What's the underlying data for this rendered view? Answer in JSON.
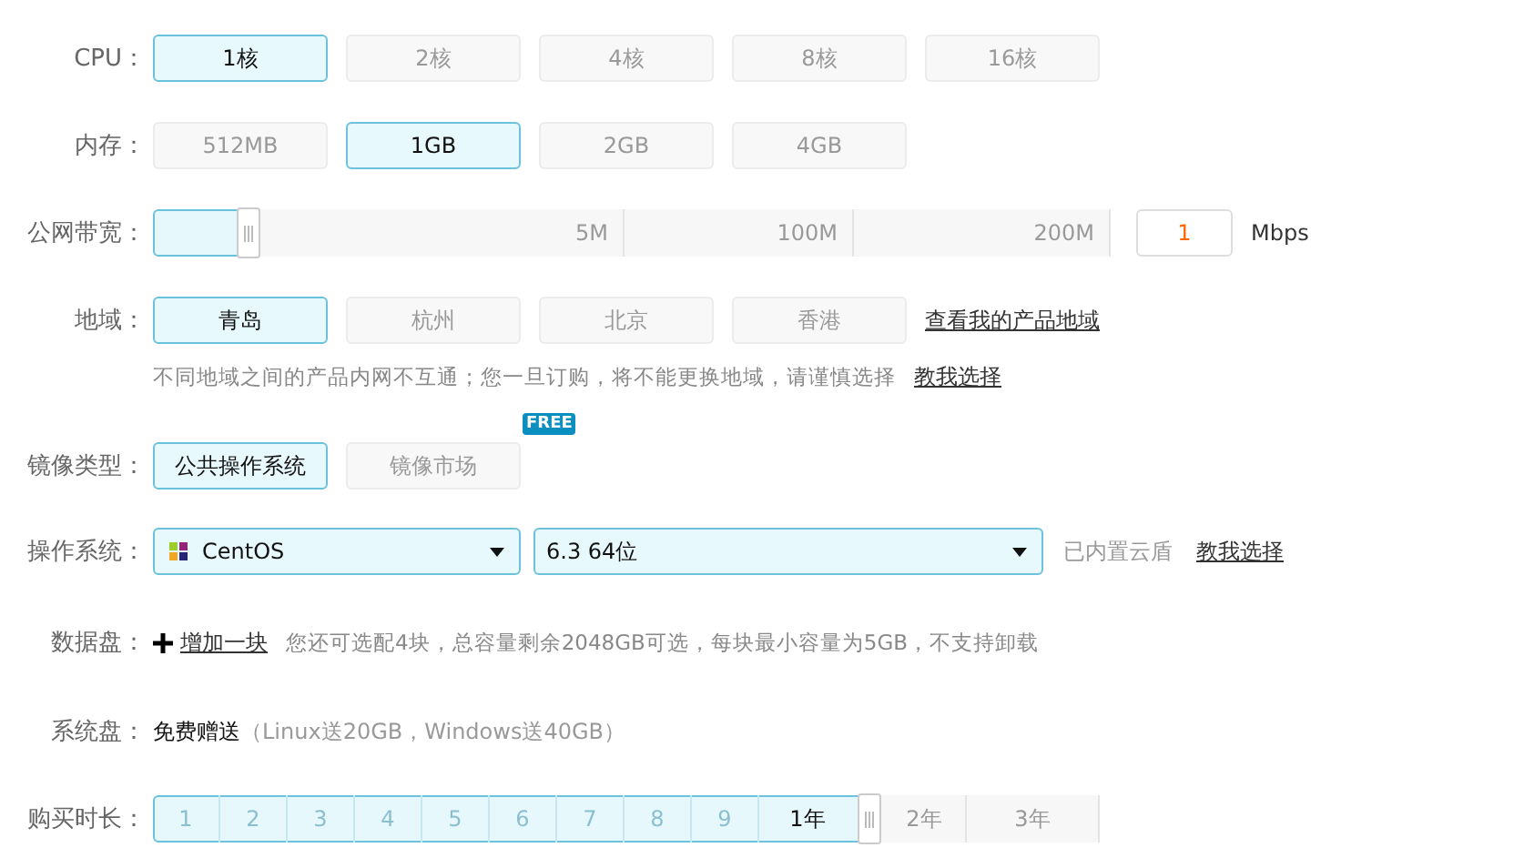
{
  "cpu": {
    "label": "CPU：",
    "options": [
      {
        "label": "1核",
        "selected": true
      },
      {
        "label": "2核",
        "selected": false
      },
      {
        "label": "4核",
        "selected": false
      },
      {
        "label": "8核",
        "selected": false
      },
      {
        "label": "16核",
        "selected": false
      }
    ]
  },
  "memory": {
    "label": "内存：",
    "options": [
      {
        "label": "512MB",
        "selected": false
      },
      {
        "label": "1GB",
        "selected": true
      },
      {
        "label": "2GB",
        "selected": false
      },
      {
        "label": "4GB",
        "selected": false
      }
    ]
  },
  "bandwidth": {
    "label": "公网带宽：",
    "level": 0.1,
    "marks": [
      "5M",
      "100M",
      "200M"
    ],
    "value": "1",
    "unit": "Mbps"
  },
  "region": {
    "label": "地域：",
    "options": [
      {
        "label": "青岛",
        "selected": true
      },
      {
        "label": "杭州",
        "selected": false
      },
      {
        "label": "北京",
        "selected": false
      },
      {
        "label": "香港",
        "selected": false
      }
    ],
    "link": "查看我的产品地域",
    "hint": "不同地域之间的产品内网不互通；您一旦订购，将不能更换地域，请谨慎选择",
    "hint_link": "教我选择"
  },
  "image_type": {
    "label": "镜像类型：",
    "options": [
      {
        "label": "公共操作系统",
        "selected": true
      },
      {
        "label": "镜像市场",
        "selected": false,
        "badge": "FREE"
      }
    ]
  },
  "os": {
    "label": "操作系统：",
    "system": "CentOS",
    "version": "6.3 64位",
    "note": "已内置云盾",
    "link": "教我选择"
  },
  "data_disk": {
    "label": "数据盘：",
    "action": "增加一块",
    "hint": "您还可选配4块，总容量剩余2048GB可选，每块最小容量为5GB，不支持卸载"
  },
  "system_disk": {
    "label": "系统盘：",
    "value": "免费赠送",
    "note": "（Linux送20GB，Windows送40GB）"
  },
  "duration": {
    "label": "购买时长：",
    "level": 0.758,
    "segments": [
      {
        "label": "1",
        "selected": false
      },
      {
        "label": "2",
        "selected": false
      },
      {
        "label": "3",
        "selected": false
      },
      {
        "label": "4",
        "selected": false
      },
      {
        "label": "5",
        "selected": false
      },
      {
        "label": "6",
        "selected": false
      },
      {
        "label": "7",
        "selected": false
      },
      {
        "label": "8",
        "selected": false
      },
      {
        "label": "9",
        "selected": false
      },
      {
        "label": "1年",
        "selected": true
      },
      {
        "label": "2年",
        "selected": false
      },
      {
        "label": "3年",
        "selected": false
      }
    ]
  }
}
